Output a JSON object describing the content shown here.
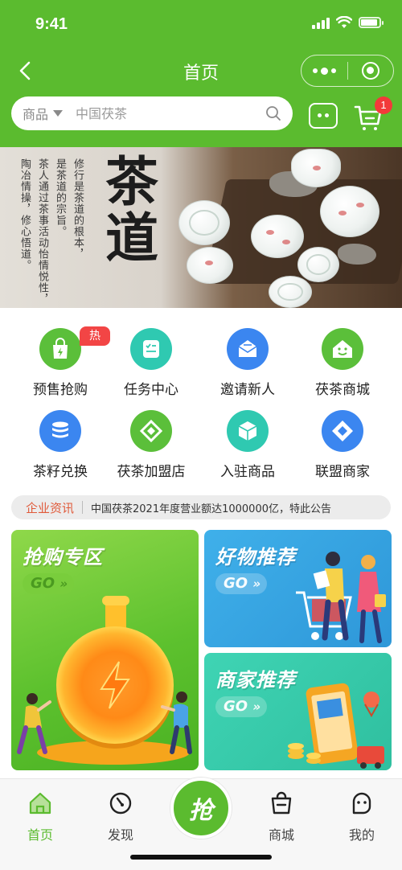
{
  "status_bar": {
    "time": "9:41"
  },
  "nav": {
    "title": "首页"
  },
  "search": {
    "category": "商品",
    "placeholder": "中国茯茶"
  },
  "cart": {
    "badge_count": "1"
  },
  "banner": {
    "calligraphy": "茶道",
    "poem_lines": [
      "修行是茶道的根本，",
      "是茶道的宗旨。",
      "茶人通过茶事活动怡情悦性，",
      "陶冶情操，修心悟道。"
    ]
  },
  "categories": [
    {
      "label": "预售抢购",
      "icon": "shopping-bag-icon",
      "color": "#5bbf3a",
      "tag": "热门"
    },
    {
      "label": "任务中心",
      "icon": "task-list-icon",
      "color": "#2fc9b1"
    },
    {
      "label": "邀请新人",
      "icon": "invite-envelope-icon",
      "color": "#3b86f0"
    },
    {
      "label": "茯茶商城",
      "icon": "mall-house-icon",
      "color": "#5bbf3a"
    },
    {
      "label": "茶籽兑换",
      "icon": "exchange-database-icon",
      "color": "#3b86f0"
    },
    {
      "label": "茯茶加盟店",
      "icon": "franchise-icon",
      "color": "#5bbf3a"
    },
    {
      "label": "入驻商品",
      "icon": "product-box-icon",
      "color": "#2fc9b1"
    },
    {
      "label": "联盟商家",
      "icon": "alliance-icon",
      "color": "#3b86f0"
    }
  ],
  "notice": {
    "title": "企业资讯",
    "text": "中国茯茶2021年度营业额达1000000亿，特此公告"
  },
  "promos": {
    "rush": {
      "title": "抢购专区",
      "go": "GO"
    },
    "goods": {
      "title": "好物推荐",
      "go": "GO"
    },
    "merchant": {
      "title": "商家推荐",
      "go": "GO"
    }
  },
  "tabs": [
    {
      "label": "首页",
      "icon": "home-icon",
      "active": true
    },
    {
      "label": "发现",
      "icon": "discover-icon"
    },
    {
      "label": "抢",
      "icon": "rush-icon"
    },
    {
      "label": "商城",
      "icon": "shop-bag-icon"
    },
    {
      "label": "我的",
      "icon": "profile-icon"
    }
  ],
  "colors": {
    "brand_green": "#5bbb2f",
    "badge_red": "#f23a3a",
    "notice_red": "#e05a3a"
  }
}
